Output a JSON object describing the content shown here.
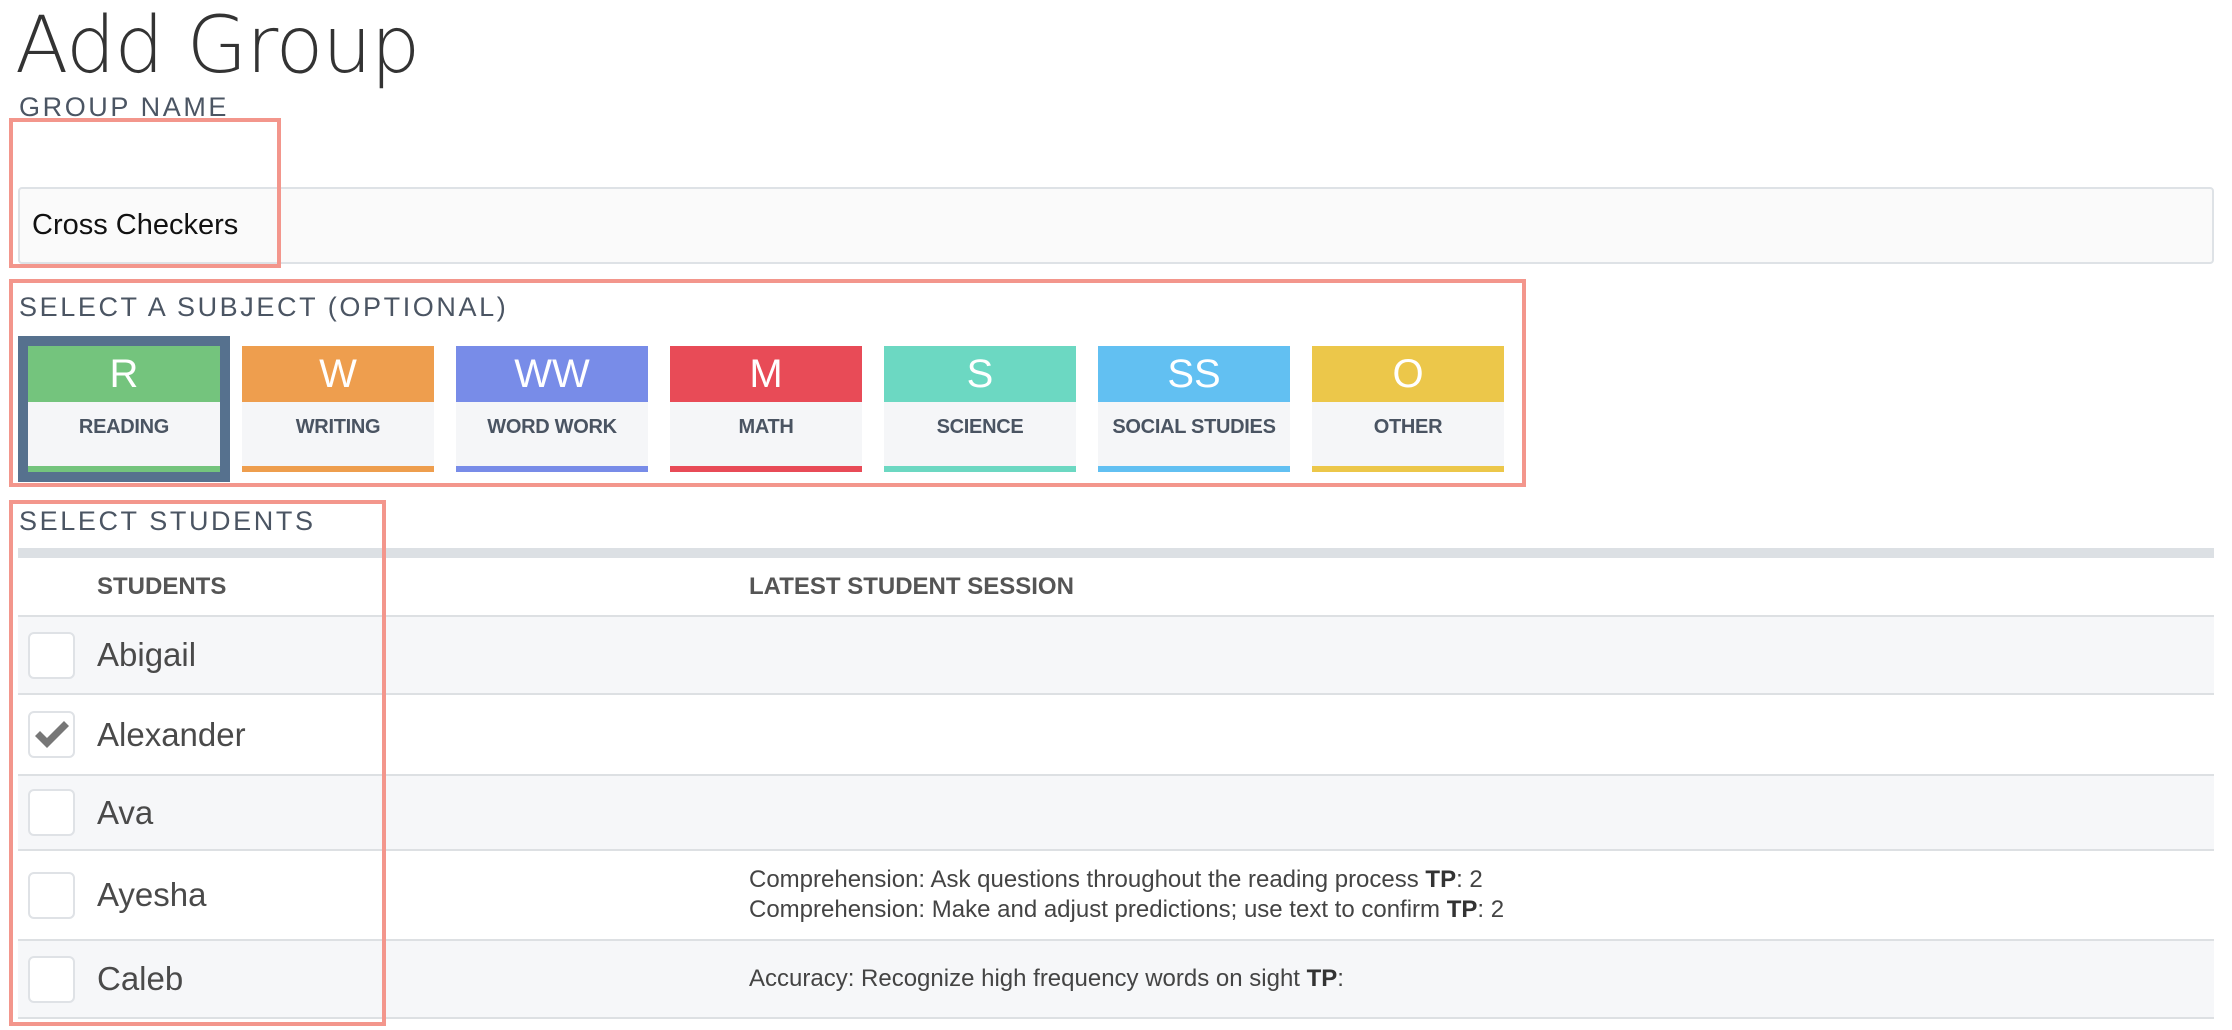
{
  "page": {
    "title": "Add Group"
  },
  "group_name": {
    "label": "GROUP NAME",
    "value": "Cross Checkers"
  },
  "subject": {
    "label": "SELECT A SUBJECT (OPTIONAL)",
    "selected": "READING",
    "tiles": [
      {
        "abbr": "R",
        "label": "READING",
        "color": "#74C47D",
        "selected": true
      },
      {
        "abbr": "W",
        "label": "WRITING",
        "color": "#EE9E4E",
        "selected": false
      },
      {
        "abbr": "WW",
        "label": "WORD WORK",
        "color": "#788CE8",
        "selected": false
      },
      {
        "abbr": "M",
        "label": "MATH",
        "color": "#E84B57",
        "selected": false
      },
      {
        "abbr": "S",
        "label": "SCIENCE",
        "color": "#6CD8C2",
        "selected": false
      },
      {
        "abbr": "SS",
        "label": "SOCIAL STUDIES",
        "color": "#62C0F2",
        "selected": false
      },
      {
        "abbr": "O",
        "label": "OTHER",
        "color": "#ECC74A",
        "selected": false
      }
    ]
  },
  "students": {
    "label": "SELECT STUDENTS",
    "columns": {
      "students": "STUDENTS",
      "session": "LATEST STUDENT SESSION"
    },
    "rows": [
      {
        "name": "Abigail",
        "checked": false,
        "session": []
      },
      {
        "name": "Alexander",
        "checked": true,
        "session": []
      },
      {
        "name": "Ava",
        "checked": false,
        "session": []
      },
      {
        "name": "Ayesha",
        "checked": false,
        "session": [
          {
            "text": "Comprehension: Ask questions throughout the reading process ",
            "tp_label": "TP",
            "tp_value": ": 2"
          },
          {
            "text": "Comprehension: Make and adjust predictions; use text to confirm ",
            "tp_label": "TP",
            "tp_value": ": 2"
          }
        ]
      },
      {
        "name": "Caleb",
        "checked": false,
        "session": [
          {
            "text": "Accuracy: Recognize high frequency words on sight ",
            "tp_label": "TP",
            "tp_value": ":"
          }
        ]
      }
    ]
  },
  "colors": {
    "highlight": "#F3968C",
    "selected_border": "#56718E"
  }
}
